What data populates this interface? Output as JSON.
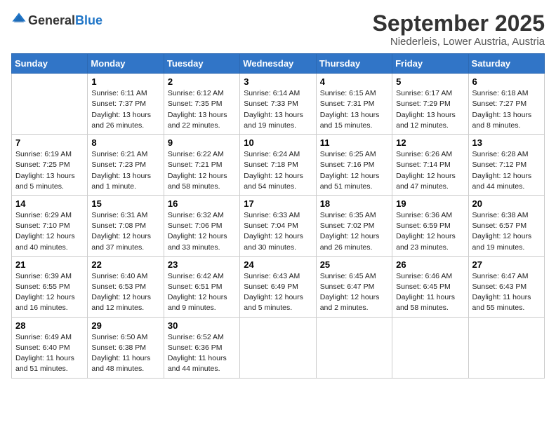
{
  "header": {
    "logo_general": "General",
    "logo_blue": "Blue",
    "month_title": "September 2025",
    "location": "Niederleis, Lower Austria, Austria"
  },
  "days_of_week": [
    "Sunday",
    "Monday",
    "Tuesday",
    "Wednesday",
    "Thursday",
    "Friday",
    "Saturday"
  ],
  "weeks": [
    [
      {
        "day": "",
        "info": ""
      },
      {
        "day": "1",
        "info": "Sunrise: 6:11 AM\nSunset: 7:37 PM\nDaylight: 13 hours\nand 26 minutes."
      },
      {
        "day": "2",
        "info": "Sunrise: 6:12 AM\nSunset: 7:35 PM\nDaylight: 13 hours\nand 22 minutes."
      },
      {
        "day": "3",
        "info": "Sunrise: 6:14 AM\nSunset: 7:33 PM\nDaylight: 13 hours\nand 19 minutes."
      },
      {
        "day": "4",
        "info": "Sunrise: 6:15 AM\nSunset: 7:31 PM\nDaylight: 13 hours\nand 15 minutes."
      },
      {
        "day": "5",
        "info": "Sunrise: 6:17 AM\nSunset: 7:29 PM\nDaylight: 13 hours\nand 12 minutes."
      },
      {
        "day": "6",
        "info": "Sunrise: 6:18 AM\nSunset: 7:27 PM\nDaylight: 13 hours\nand 8 minutes."
      }
    ],
    [
      {
        "day": "7",
        "info": "Sunrise: 6:19 AM\nSunset: 7:25 PM\nDaylight: 13 hours\nand 5 minutes."
      },
      {
        "day": "8",
        "info": "Sunrise: 6:21 AM\nSunset: 7:23 PM\nDaylight: 13 hours\nand 1 minute."
      },
      {
        "day": "9",
        "info": "Sunrise: 6:22 AM\nSunset: 7:21 PM\nDaylight: 12 hours\nand 58 minutes."
      },
      {
        "day": "10",
        "info": "Sunrise: 6:24 AM\nSunset: 7:18 PM\nDaylight: 12 hours\nand 54 minutes."
      },
      {
        "day": "11",
        "info": "Sunrise: 6:25 AM\nSunset: 7:16 PM\nDaylight: 12 hours\nand 51 minutes."
      },
      {
        "day": "12",
        "info": "Sunrise: 6:26 AM\nSunset: 7:14 PM\nDaylight: 12 hours\nand 47 minutes."
      },
      {
        "day": "13",
        "info": "Sunrise: 6:28 AM\nSunset: 7:12 PM\nDaylight: 12 hours\nand 44 minutes."
      }
    ],
    [
      {
        "day": "14",
        "info": "Sunrise: 6:29 AM\nSunset: 7:10 PM\nDaylight: 12 hours\nand 40 minutes."
      },
      {
        "day": "15",
        "info": "Sunrise: 6:31 AM\nSunset: 7:08 PM\nDaylight: 12 hours\nand 37 minutes."
      },
      {
        "day": "16",
        "info": "Sunrise: 6:32 AM\nSunset: 7:06 PM\nDaylight: 12 hours\nand 33 minutes."
      },
      {
        "day": "17",
        "info": "Sunrise: 6:33 AM\nSunset: 7:04 PM\nDaylight: 12 hours\nand 30 minutes."
      },
      {
        "day": "18",
        "info": "Sunrise: 6:35 AM\nSunset: 7:02 PM\nDaylight: 12 hours\nand 26 minutes."
      },
      {
        "day": "19",
        "info": "Sunrise: 6:36 AM\nSunset: 6:59 PM\nDaylight: 12 hours\nand 23 minutes."
      },
      {
        "day": "20",
        "info": "Sunrise: 6:38 AM\nSunset: 6:57 PM\nDaylight: 12 hours\nand 19 minutes."
      }
    ],
    [
      {
        "day": "21",
        "info": "Sunrise: 6:39 AM\nSunset: 6:55 PM\nDaylight: 12 hours\nand 16 minutes."
      },
      {
        "day": "22",
        "info": "Sunrise: 6:40 AM\nSunset: 6:53 PM\nDaylight: 12 hours\nand 12 minutes."
      },
      {
        "day": "23",
        "info": "Sunrise: 6:42 AM\nSunset: 6:51 PM\nDaylight: 12 hours\nand 9 minutes."
      },
      {
        "day": "24",
        "info": "Sunrise: 6:43 AM\nSunset: 6:49 PM\nDaylight: 12 hours\nand 5 minutes."
      },
      {
        "day": "25",
        "info": "Sunrise: 6:45 AM\nSunset: 6:47 PM\nDaylight: 12 hours\nand 2 minutes."
      },
      {
        "day": "26",
        "info": "Sunrise: 6:46 AM\nSunset: 6:45 PM\nDaylight: 11 hours\nand 58 minutes."
      },
      {
        "day": "27",
        "info": "Sunrise: 6:47 AM\nSunset: 6:43 PM\nDaylight: 11 hours\nand 55 minutes."
      }
    ],
    [
      {
        "day": "28",
        "info": "Sunrise: 6:49 AM\nSunset: 6:40 PM\nDaylight: 11 hours\nand 51 minutes."
      },
      {
        "day": "29",
        "info": "Sunrise: 6:50 AM\nSunset: 6:38 PM\nDaylight: 11 hours\nand 48 minutes."
      },
      {
        "day": "30",
        "info": "Sunrise: 6:52 AM\nSunset: 6:36 PM\nDaylight: 11 hours\nand 44 minutes."
      },
      {
        "day": "",
        "info": ""
      },
      {
        "day": "",
        "info": ""
      },
      {
        "day": "",
        "info": ""
      },
      {
        "day": "",
        "info": ""
      }
    ]
  ]
}
